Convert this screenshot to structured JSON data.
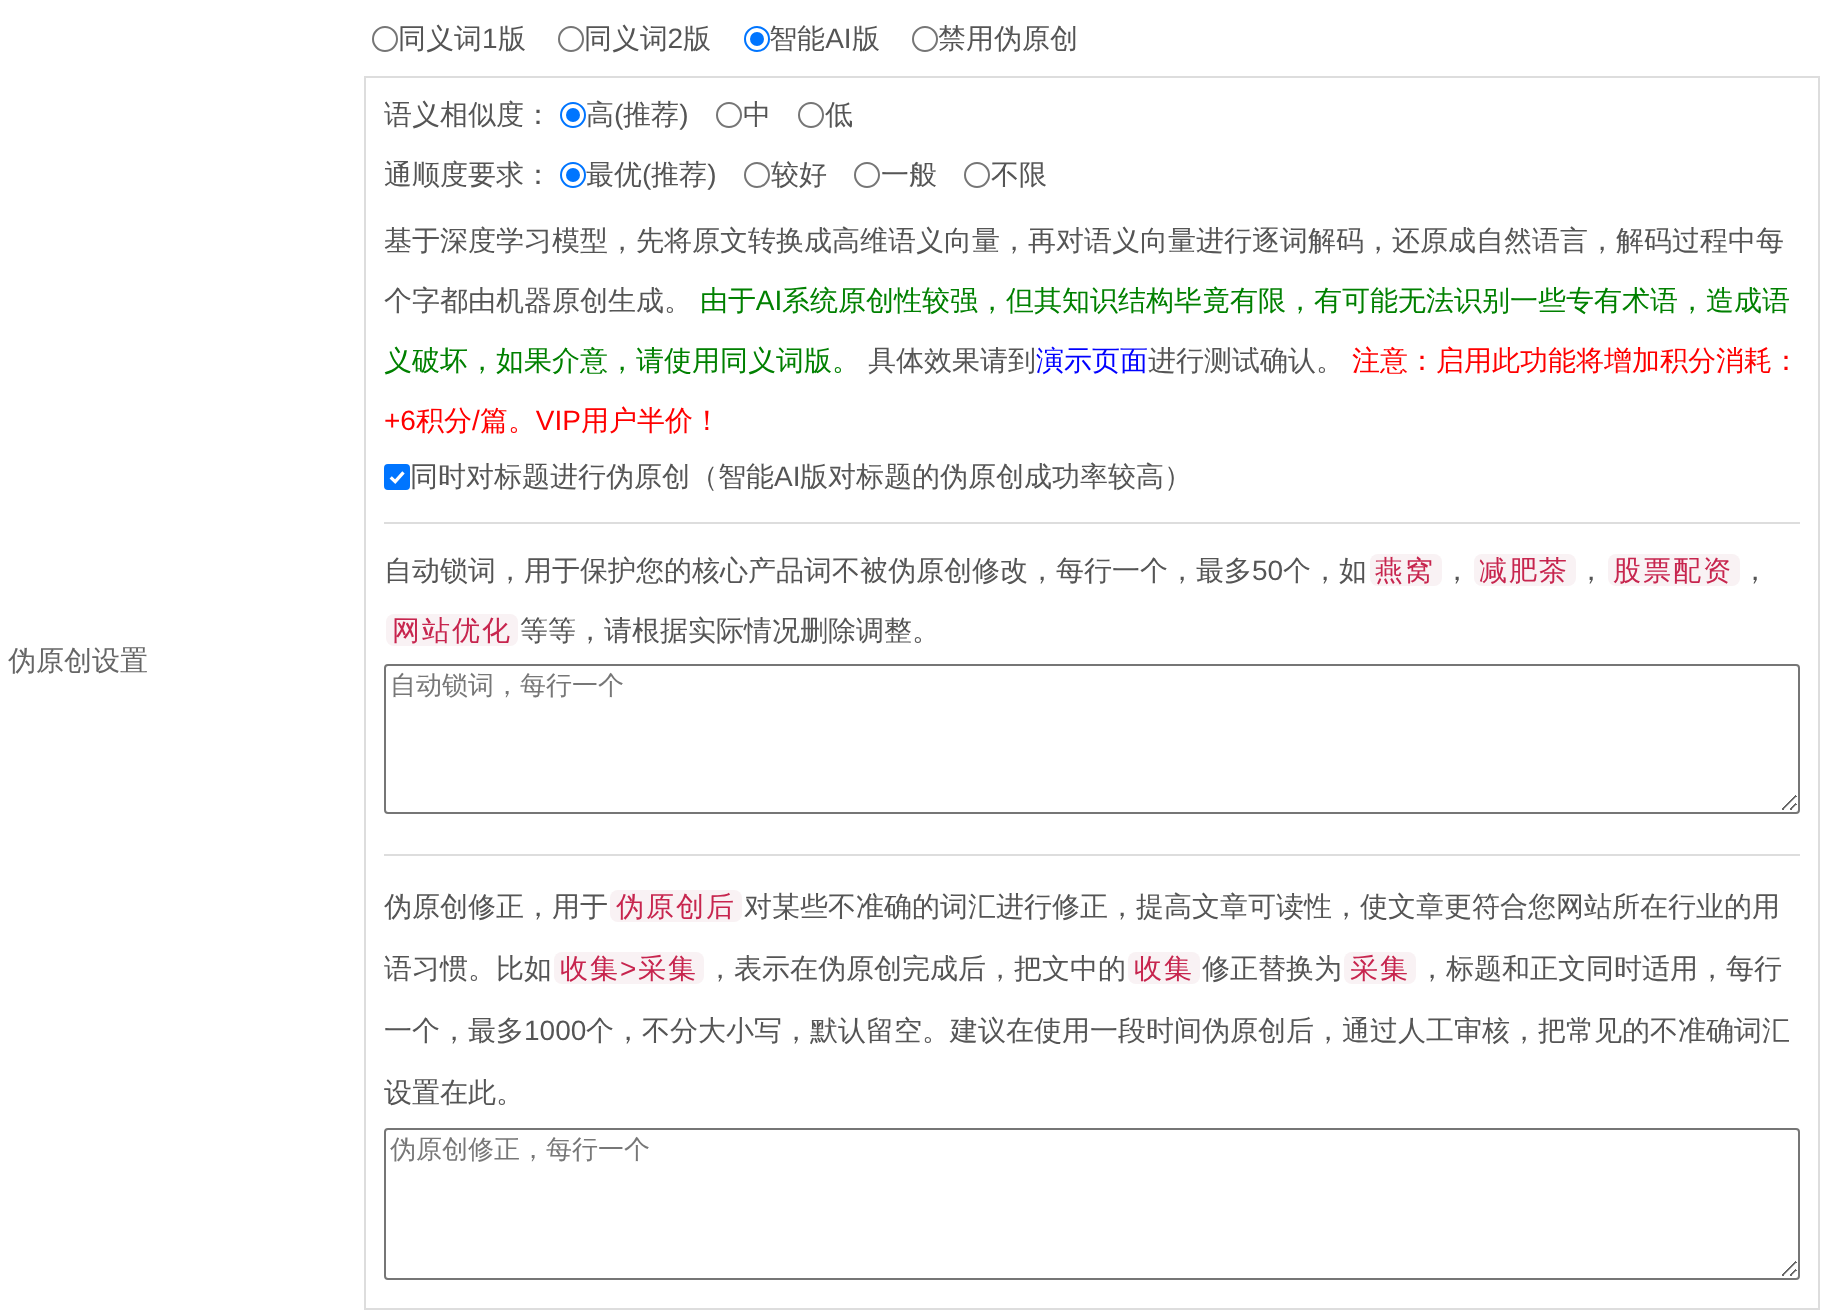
{
  "sidebar_label": "伪原创设置",
  "mode_options": [
    {
      "label": "同义词1版",
      "selected": false
    },
    {
      "label": "同义词2版",
      "selected": false
    },
    {
      "label": "智能AI版",
      "selected": true
    },
    {
      "label": "禁用伪原创",
      "selected": false
    }
  ],
  "ai_settings": {
    "similarity": {
      "label": "语义相似度：",
      "options": [
        {
          "label": "高(推荐)",
          "selected": true
        },
        {
          "label": "中",
          "selected": false
        },
        {
          "label": "低",
          "selected": false
        }
      ]
    },
    "fluency": {
      "label": "通顺度要求：",
      "options": [
        {
          "label": "最优(推荐)",
          "selected": true
        },
        {
          "label": "较好",
          "selected": false
        },
        {
          "label": "一般",
          "selected": false
        },
        {
          "label": "不限",
          "selected": false
        }
      ]
    },
    "description": [
      {
        "kind": "text",
        "text": "基于深度学习模型，先将原文转换成高维语义向量，再对语义向量进行逐词解码，还原成自然语言，解码过程中每个字都由机器原创生成。 "
      },
      {
        "kind": "green",
        "text": "由于AI系统原创性较强，但其知识结构毕竟有限，有可能无法识别一些专有术语，造成语义破坏，如果介意，请使用同义词版。"
      },
      {
        "kind": "text",
        "text": " 具体效果请到"
      },
      {
        "kind": "link",
        "text": "演示页面"
      },
      {
        "kind": "text",
        "text": "进行测试确认。 "
      },
      {
        "kind": "red",
        "text": "注意：启用此功能将增加积分消耗：+6积分/篇。VIP用户半价！"
      }
    ],
    "title_option": {
      "label": "同时对标题进行伪原创（智能AI版对标题的伪原创成功率较高）",
      "checked": true
    }
  },
  "lock_words": {
    "description": [
      {
        "kind": "text",
        "text": "自动锁词，用于保护您的核心产品词不被伪原创修改，每行一个，最多50个，如"
      },
      {
        "kind": "tag",
        "text": "燕窝"
      },
      {
        "kind": "text",
        "text": "，"
      },
      {
        "kind": "tag",
        "text": "减肥茶"
      },
      {
        "kind": "text",
        "text": "，"
      },
      {
        "kind": "tag",
        "text": "股票配资"
      },
      {
        "kind": "text",
        "text": "，"
      },
      {
        "kind": "tag",
        "text": "网站优化"
      },
      {
        "kind": "text",
        "text": "等等，请根据实际情况删除调整。"
      }
    ],
    "placeholder": "自动锁词，每行一个"
  },
  "correction": {
    "description": [
      {
        "kind": "text",
        "text": "伪原创修正，用于"
      },
      {
        "kind": "tag",
        "text": "伪原创后"
      },
      {
        "kind": "text",
        "text": "对某些不准确的词汇进行修正，提高文章可读性，使文章更符合您网站所在行业的用语习惯。比如"
      },
      {
        "kind": "tag",
        "text": "收集>采集"
      },
      {
        "kind": "text",
        "text": "，表示在伪原创完成后，把文中的"
      },
      {
        "kind": "tag",
        "text": "收集"
      },
      {
        "kind": "text",
        "text": "修正替换为"
      },
      {
        "kind": "tag",
        "text": "采集"
      },
      {
        "kind": "text",
        "text": "，标题和正文同时适用，每行一个，最多1000个，不分大小写，默认留空。建议在使用一段时间伪原创后，通过人工审核，把常见的不准确词汇设置在此。"
      }
    ],
    "placeholder": "伪原创修正，每行一个"
  }
}
